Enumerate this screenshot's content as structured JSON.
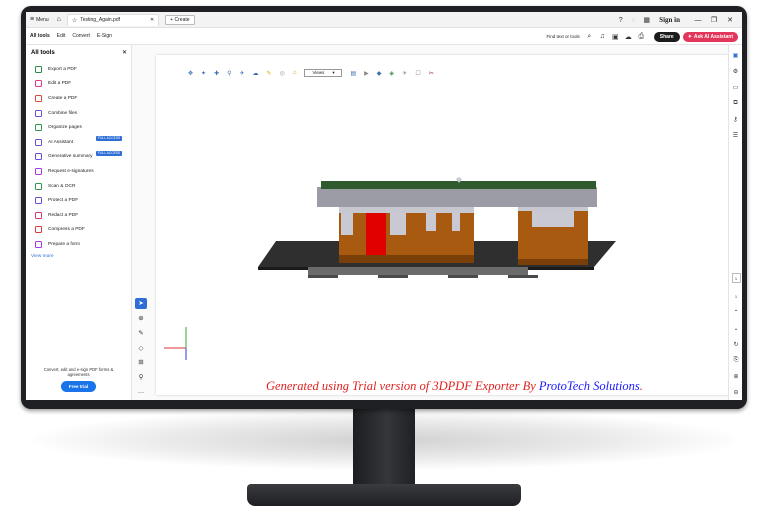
{
  "titlebar": {
    "menu_label": "Menu",
    "tab_title": "Testing_Again.pdf",
    "create_label": "Create",
    "signin_label": "Sign in"
  },
  "menubar": {
    "tabs": [
      "All tools",
      "Edit",
      "Convert",
      "E-Sign"
    ],
    "find_label": "Find text or tools",
    "share_label": "Share",
    "ai_label": "Ask AI Assistant"
  },
  "leftpanel": {
    "title": "All tools",
    "tools": [
      {
        "label": "Export a PDF",
        "color": "#2d8a4e"
      },
      {
        "label": "Edit a PDF",
        "color": "#d93a8f"
      },
      {
        "label": "Create a PDF",
        "color": "#d94a3a"
      },
      {
        "label": "Combine files",
        "color": "#6a4fd6"
      },
      {
        "label": "Organize pages",
        "color": "#2d9a4e"
      },
      {
        "label": "AI Assistant",
        "color": "#6a4fd6",
        "badge": "FULL ACCESS"
      },
      {
        "label": "Generative summary",
        "color": "#6a4fd6",
        "badge": "FULL ACCESS"
      },
      {
        "label": "Request e-signatures",
        "color": "#a43ad9"
      },
      {
        "label": "Scan & OCR",
        "color": "#2d9a4e"
      },
      {
        "label": "Protect a PDF",
        "color": "#6a4fd6"
      },
      {
        "label": "Redact a PDF",
        "color": "#d93a6a"
      },
      {
        "label": "Compress a PDF",
        "color": "#d93a3a"
      },
      {
        "label": "Prepare a form",
        "color": "#a43ad9"
      }
    ],
    "view_more": "View more",
    "bottom_text": "Convert, edit and e-sign PDF forms & agreements",
    "trial_label": "Free trial"
  },
  "toolbar3d": {
    "views_value": "Views"
  },
  "document": {
    "watermark_prefix": "Generated using Trial version of 3DPDF Exporter By ",
    "watermark_brand": "ProtoTech Solutions",
    "watermark_suffix": "."
  }
}
